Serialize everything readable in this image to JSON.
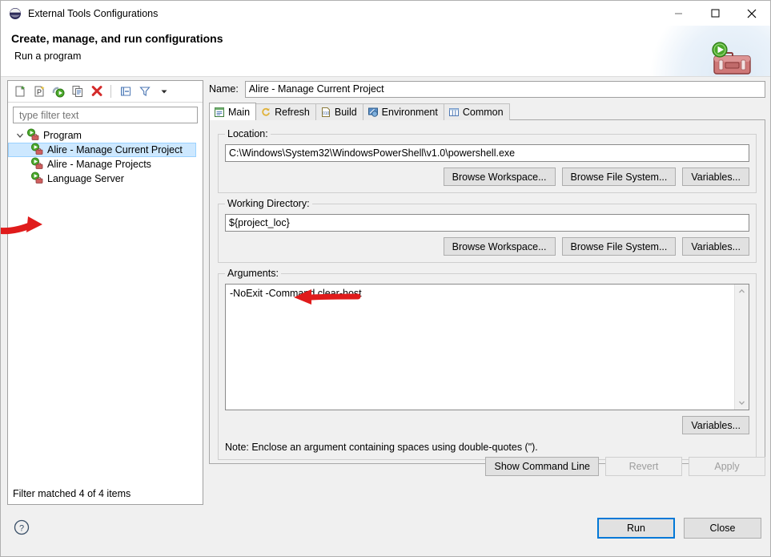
{
  "window": {
    "title": "External Tools Configurations",
    "icon": "eclipse-icon",
    "controls": {
      "minimize": "–",
      "maximize": "▢",
      "close": "✕"
    }
  },
  "banner": {
    "title": "Create, manage, and run configurations",
    "subtitle": "Run a program",
    "icon": "toolbox-run-icon"
  },
  "left_panel": {
    "toolbar": [
      {
        "name": "new-configuration-icon",
        "tooltip": "New launch configuration"
      },
      {
        "name": "new-prototype-icon",
        "tooltip": "New prototype"
      },
      {
        "name": "new-configuration-from-run-icon",
        "tooltip": "New configuration from run"
      },
      {
        "name": "duplicate-icon",
        "tooltip": "Duplicate"
      },
      {
        "name": "delete-icon",
        "tooltip": "Delete"
      },
      {
        "name": "collapse-all-icon",
        "tooltip": "Collapse All"
      },
      {
        "name": "filter-icon",
        "tooltip": "Filter"
      },
      {
        "name": "view-menu-icon",
        "tooltip": "View Menu"
      }
    ],
    "filter": {
      "value": "",
      "placeholder": "type filter text"
    },
    "tree": {
      "root": {
        "label": "Program",
        "expanded": true,
        "icon": "program-run-icon"
      },
      "children": [
        {
          "label": "Alire - Manage Current Project",
          "icon": "program-run-icon",
          "selected": true
        },
        {
          "label": "Alire - Manage Projects",
          "icon": "program-run-icon",
          "selected": false
        },
        {
          "label": "Language Server",
          "icon": "program-run-icon",
          "selected": false
        }
      ]
    },
    "status": "Filter matched 4 of 4 items"
  },
  "right_panel": {
    "name_label": "Name:",
    "name_value": "Alire - Manage Current Project",
    "tabs": [
      {
        "label": "Main",
        "icon": "main-tab-icon",
        "active": true
      },
      {
        "label": "Refresh",
        "icon": "refresh-tab-icon",
        "active": false
      },
      {
        "label": "Build",
        "icon": "build-tab-icon",
        "active": false
      },
      {
        "label": "Environment",
        "icon": "environment-tab-icon",
        "active": false
      },
      {
        "label": "Common",
        "icon": "common-tab-icon",
        "active": false
      }
    ],
    "location": {
      "legend": "Location:",
      "value": "C:\\Windows\\System32\\WindowsPowerShell\\v1.0\\powershell.exe",
      "buttons": [
        "Browse Workspace...",
        "Browse File System...",
        "Variables..."
      ]
    },
    "working_directory": {
      "legend": "Working Directory:",
      "value": "${project_loc}",
      "buttons": [
        "Browse Workspace...",
        "Browse File System...",
        "Variables..."
      ]
    },
    "arguments": {
      "legend": "Arguments:",
      "value": "-NoExit -Command clear-host",
      "variables_button": "Variables...",
      "note": "Note: Enclose an argument containing spaces using double-quotes (\")."
    },
    "actions": [
      {
        "label": "Show Command Line",
        "enabled": true
      },
      {
        "label": "Revert",
        "enabled": false
      },
      {
        "label": "Apply",
        "enabled": false
      }
    ]
  },
  "footer": {
    "help_icon": "help-icon",
    "buttons": [
      {
        "label": "Run",
        "default": true
      },
      {
        "label": "Close",
        "default": false
      }
    ]
  },
  "annotations": [
    {
      "name": "annotation-arrow-tree-selection",
      "direction": "right",
      "color": "#e01b1b"
    },
    {
      "name": "annotation-arrow-working-directory",
      "direction": "left",
      "color": "#e01b1b"
    }
  ],
  "colors": {
    "accent": "#0078d7",
    "selection": "#cde8ff",
    "annotation": "#e01b1b",
    "dialog_bg": "#f0f0f0"
  }
}
